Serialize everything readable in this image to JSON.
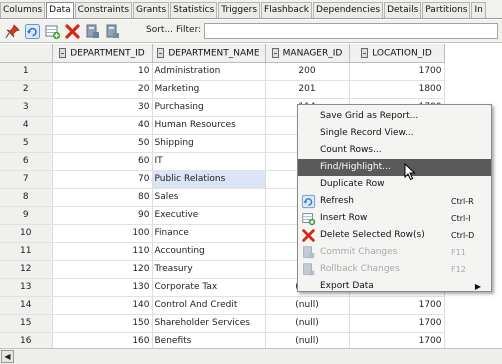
{
  "tabs": [
    "Columns",
    "Data",
    "Constraints",
    "Grants",
    "Statistics",
    "Triggers",
    "Flashback",
    "Dependencies",
    "Details",
    "Partitions",
    "In"
  ],
  "active_tab": "Data",
  "toolbar": {
    "sort_label": "Sort...",
    "filter_label": "Filter:",
    "filter_value": "",
    "icons": [
      "pin-icon",
      "refresh-icon",
      "insert-row-icon",
      "delete-row-icon",
      "commit-icon",
      "rollback-icon"
    ]
  },
  "grid": {
    "columns": [
      "DEPARTMENT_ID",
      "DEPARTMENT_NAME",
      "MANAGER_ID",
      "LOCATION_ID"
    ],
    "rows": [
      {
        "n": "1",
        "id": "10",
        "name": "Administration",
        "mgr": "200",
        "loc": "1700"
      },
      {
        "n": "2",
        "id": "20",
        "name": "Marketing",
        "mgr": "201",
        "loc": "1800"
      },
      {
        "n": "3",
        "id": "30",
        "name": "Purchasing",
        "mgr": "114",
        "loc": "1700"
      },
      {
        "n": "4",
        "id": "40",
        "name": "Human Resources",
        "mgr": "",
        "loc": ""
      },
      {
        "n": "5",
        "id": "50",
        "name": "Shipping",
        "mgr": "",
        "loc": ""
      },
      {
        "n": "6",
        "id": "60",
        "name": "IT",
        "mgr": "",
        "loc": ""
      },
      {
        "n": "7",
        "id": "70",
        "name": "Public Relations",
        "mgr": "",
        "loc": ""
      },
      {
        "n": "8",
        "id": "80",
        "name": "Sales",
        "mgr": "",
        "loc": ""
      },
      {
        "n": "9",
        "id": "90",
        "name": "Executive",
        "mgr": "",
        "loc": ""
      },
      {
        "n": "10",
        "id": "100",
        "name": "Finance",
        "mgr": "",
        "loc": ""
      },
      {
        "n": "11",
        "id": "110",
        "name": "Accounting",
        "mgr": "",
        "loc": ""
      },
      {
        "n": "12",
        "id": "120",
        "name": "Treasury",
        "mgr": "",
        "loc": ""
      },
      {
        "n": "13",
        "id": "130",
        "name": "Corporate Tax",
        "mgr": "(null)",
        "loc": "1700"
      },
      {
        "n": "14",
        "id": "140",
        "name": "Control And Credit",
        "mgr": "(null)",
        "loc": "1700"
      },
      {
        "n": "15",
        "id": "150",
        "name": "Shareholder Services",
        "mgr": "(null)",
        "loc": "1700"
      },
      {
        "n": "16",
        "id": "160",
        "name": "Benefits",
        "mgr": "(null)",
        "loc": "1700"
      }
    ],
    "selected_cell": "Public Relations"
  },
  "context_menu": {
    "items": [
      {
        "label": "Save Grid as Report...",
        "shortcut": "",
        "icon": "",
        "disabled": false
      },
      {
        "label": "Single Record View...",
        "shortcut": "",
        "icon": "",
        "disabled": false
      },
      {
        "label": "Count Rows...",
        "shortcut": "",
        "icon": "",
        "disabled": false
      },
      {
        "label": "Find/Highlight...",
        "shortcut": "",
        "icon": "",
        "disabled": false,
        "highlighted": true
      },
      {
        "label": "Duplicate Row",
        "shortcut": "",
        "icon": "",
        "disabled": false
      },
      {
        "label": "Refresh",
        "shortcut": "Ctrl-R",
        "icon": "refresh-icon",
        "disabled": false
      },
      {
        "label": "Insert Row",
        "shortcut": "Ctrl-I",
        "icon": "insert-row-icon",
        "disabled": false
      },
      {
        "label": "Delete Selected Row(s)",
        "shortcut": "Ctrl-D",
        "icon": "delete-row-icon",
        "disabled": false
      },
      {
        "label": "Commit Changes",
        "shortcut": "F11",
        "icon": "commit-icon",
        "disabled": true
      },
      {
        "label": "Rollback Changes",
        "shortcut": "F12",
        "icon": "rollback-icon",
        "disabled": true
      },
      {
        "label": "Export Data",
        "shortcut": "",
        "icon": "",
        "disabled": false,
        "submenu": true
      }
    ]
  },
  "colors": {
    "selection": "#dbe4f4",
    "menu_highlight": "#5a5a5a",
    "delete_red": "#d42a1a",
    "refresh_blue": "#2f78c4",
    "insert_green": "#3c9a2e"
  }
}
